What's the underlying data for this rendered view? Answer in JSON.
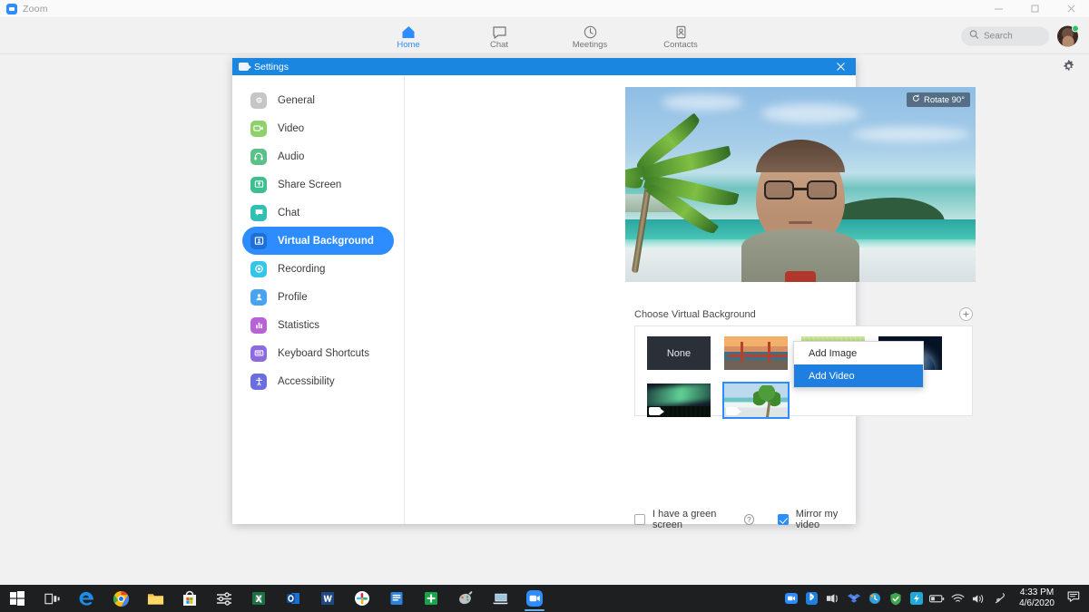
{
  "window": {
    "app_title": "Zoom",
    "controls": {
      "minimize": "minimize-button",
      "maximize": "maximize-button",
      "close": "close-button"
    }
  },
  "navbar": {
    "items": [
      {
        "label": "Home",
        "icon": "home-icon",
        "active": true
      },
      {
        "label": "Chat",
        "icon": "chat-bubble-icon",
        "active": false
      },
      {
        "label": "Meetings",
        "icon": "clock-icon",
        "active": false
      },
      {
        "label": "Contacts",
        "icon": "contact-card-icon",
        "active": false
      }
    ],
    "search": {
      "placeholder": "Search",
      "icon": "search-icon"
    },
    "avatar": {
      "name": "user-avatar",
      "presence": "available"
    },
    "settings_gear": "gear-icon"
  },
  "settings_dialog": {
    "title": "Settings",
    "close_label": "✕",
    "sidebar": [
      {
        "label": "General",
        "icon": "gear-icon",
        "color": "#c6c6c6",
        "active": false
      },
      {
        "label": "Video",
        "icon": "video-camera-icon",
        "color": "#8ed06a",
        "active": false
      },
      {
        "label": "Audio",
        "icon": "headphones-icon",
        "color": "#5cc08a",
        "active": false
      },
      {
        "label": "Share Screen",
        "icon": "share-screen-icon",
        "color": "#3cc08f",
        "active": false
      },
      {
        "label": "Chat",
        "icon": "chat-bubble-icon",
        "color": "#2fc0b3",
        "active": false
      },
      {
        "label": "Virtual Background",
        "icon": "person-card-icon",
        "color": "#2d8cff",
        "active": true
      },
      {
        "label": "Recording",
        "icon": "record-dot-icon",
        "color": "#35c5e8",
        "active": false
      },
      {
        "label": "Profile",
        "icon": "person-icon",
        "color": "#4aa3f0",
        "active": false
      },
      {
        "label": "Statistics",
        "icon": "bar-chart-icon",
        "color": "#b763d6",
        "active": false
      },
      {
        "label": "Keyboard Shortcuts",
        "icon": "keyboard-icon",
        "color": "#8d6ae0",
        "active": false
      },
      {
        "label": "Accessibility",
        "icon": "accessibility-icon",
        "color": "#6a6fe0",
        "active": false
      }
    ],
    "preview": {
      "rotate_button": "Rotate 90°",
      "rotate_icon": "rotate-icon",
      "description": "virtual-background-video-preview"
    },
    "choose_section": {
      "label": "Choose Virtual Background",
      "add_button_icon": "plus-circle-icon",
      "thumbnails": [
        {
          "name": "None",
          "kind": "none",
          "selected": false,
          "has_video_badge": false,
          "art": "none"
        },
        {
          "name": "Golden Gate Bridge",
          "kind": "image",
          "selected": false,
          "has_video_badge": false,
          "art": "bridge"
        },
        {
          "name": "Grass",
          "kind": "image",
          "selected": false,
          "has_video_badge": false,
          "art": "grass"
        },
        {
          "name": "Earth from space",
          "kind": "image",
          "selected": false,
          "has_video_badge": false,
          "art": "earth"
        },
        {
          "name": "Aurora",
          "kind": "video",
          "selected": false,
          "has_video_badge": true,
          "art": "aurora"
        },
        {
          "name": "Beach with palm",
          "kind": "video",
          "selected": true,
          "has_video_badge": true,
          "art": "beach"
        }
      ]
    },
    "context_menu": {
      "items": [
        {
          "label": "Add Image",
          "highlighted": false
        },
        {
          "label": "Add Video",
          "highlighted": true
        }
      ]
    },
    "options": [
      {
        "label": "I have a green screen",
        "checked": false,
        "help_icon": "question-mark-icon",
        "help_glyph": "?"
      },
      {
        "label": "Mirror my video",
        "checked": true,
        "help_icon": null,
        "help_glyph": ""
      }
    ]
  },
  "taskbar": {
    "apps": [
      {
        "name": "start-button",
        "label": "Start"
      },
      {
        "name": "task-view-button",
        "label": "Task View"
      },
      {
        "name": "taskbar-edge",
        "label": "Microsoft Edge"
      },
      {
        "name": "taskbar-chrome",
        "label": "Google Chrome"
      },
      {
        "name": "taskbar-file-explorer",
        "label": "File Explorer"
      },
      {
        "name": "taskbar-microsoft-store",
        "label": "Microsoft Store"
      },
      {
        "name": "taskbar-settings-app",
        "label": "Settings"
      },
      {
        "name": "taskbar-excel",
        "label": "Excel"
      },
      {
        "name": "taskbar-outlook",
        "label": "Outlook"
      },
      {
        "name": "taskbar-word",
        "label": "Word"
      },
      {
        "name": "taskbar-slack",
        "label": "Slack"
      },
      {
        "name": "taskbar-docs",
        "label": "Docs"
      },
      {
        "name": "taskbar-evernote",
        "label": "Evernote"
      },
      {
        "name": "taskbar-paint",
        "label": "Paint"
      },
      {
        "name": "taskbar-remote-desktop",
        "label": "Remote Desktop"
      },
      {
        "name": "taskbar-zoom",
        "label": "Zoom"
      }
    ],
    "tray": [
      {
        "name": "tray-zoom-icon",
        "glyph": "zoom"
      },
      {
        "name": "tray-bluetooth-icon",
        "glyph": "bluetooth"
      },
      {
        "name": "tray-headset-icon",
        "glyph": "headset"
      },
      {
        "name": "tray-dropbox-icon",
        "glyph": "dropbox"
      },
      {
        "name": "tray-update-icon",
        "glyph": "update"
      },
      {
        "name": "tray-security-icon",
        "glyph": "shield"
      },
      {
        "name": "tray-app-icon",
        "glyph": "app"
      },
      {
        "name": "tray-battery-icon",
        "glyph": "battery"
      },
      {
        "name": "tray-wifi-icon",
        "glyph": "wifi"
      },
      {
        "name": "tray-volume-icon",
        "glyph": "volume"
      },
      {
        "name": "tray-pen-icon",
        "glyph": "pen"
      }
    ],
    "clock": {
      "time": "4:33 PM",
      "date": "4/6/2020"
    },
    "action_center_icon": "action-center-icon"
  },
  "colors": {
    "zoom_blue": "#2d8cff",
    "dialog_title_blue": "#1a86e0",
    "menu_highlight": "#1e7fe0",
    "taskbar": "#1d1f21"
  }
}
